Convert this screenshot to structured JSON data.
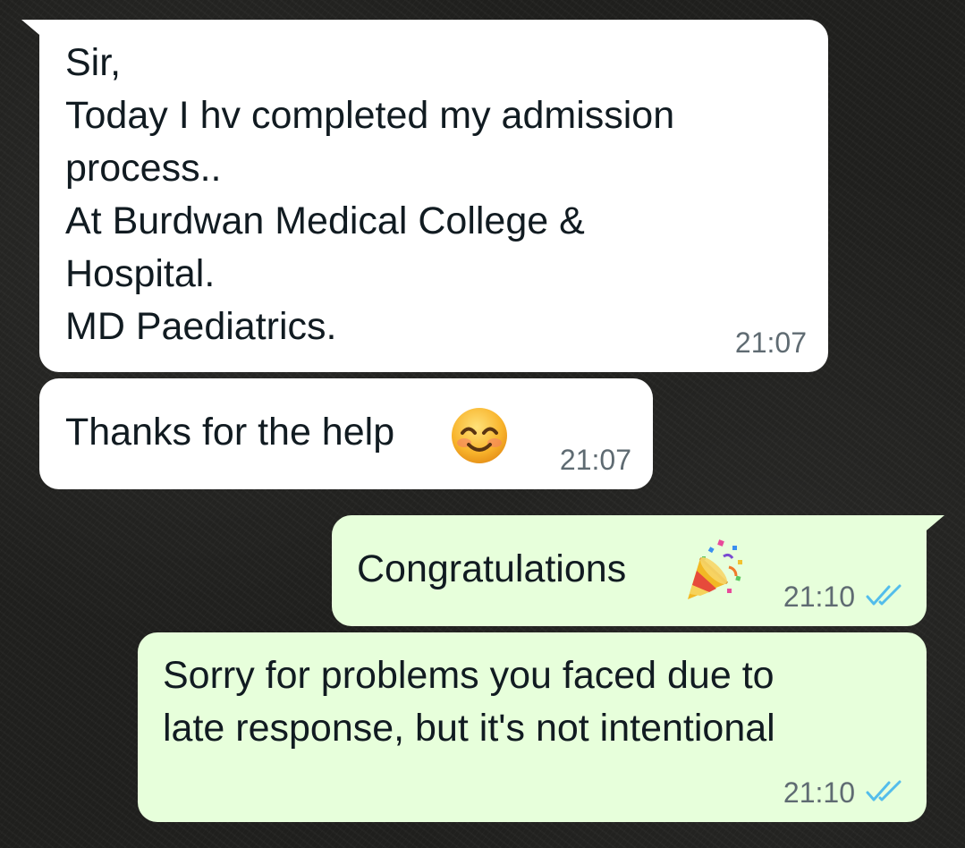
{
  "messages": [
    {
      "direction": "incoming",
      "lines": [
        "Sir,",
        "Today I hv completed my admission",
        "process..",
        "At Burdwan Medical College &",
        "Hospital.",
        "MD Paediatrics."
      ],
      "time": "21:07"
    },
    {
      "direction": "incoming",
      "lines": [
        "Thanks for the help"
      ],
      "emoji": "smiling-face-icon",
      "time": "21:07"
    },
    {
      "direction": "outgoing",
      "lines": [
        "Congratulations"
      ],
      "emoji": "party-popper-icon",
      "time": "21:10",
      "status": "read"
    },
    {
      "direction": "outgoing",
      "lines": [
        "Sorry for problems you faced due to",
        "late response, but it's not intentional"
      ],
      "time": "21:10",
      "status": "read"
    }
  ],
  "colors": {
    "background": "#1f1f1d",
    "incoming_bubble": "#ffffff",
    "outgoing_bubble": "#e7ffdb",
    "read_tick": "#53bdeb",
    "time_text": "#5f6b72"
  }
}
